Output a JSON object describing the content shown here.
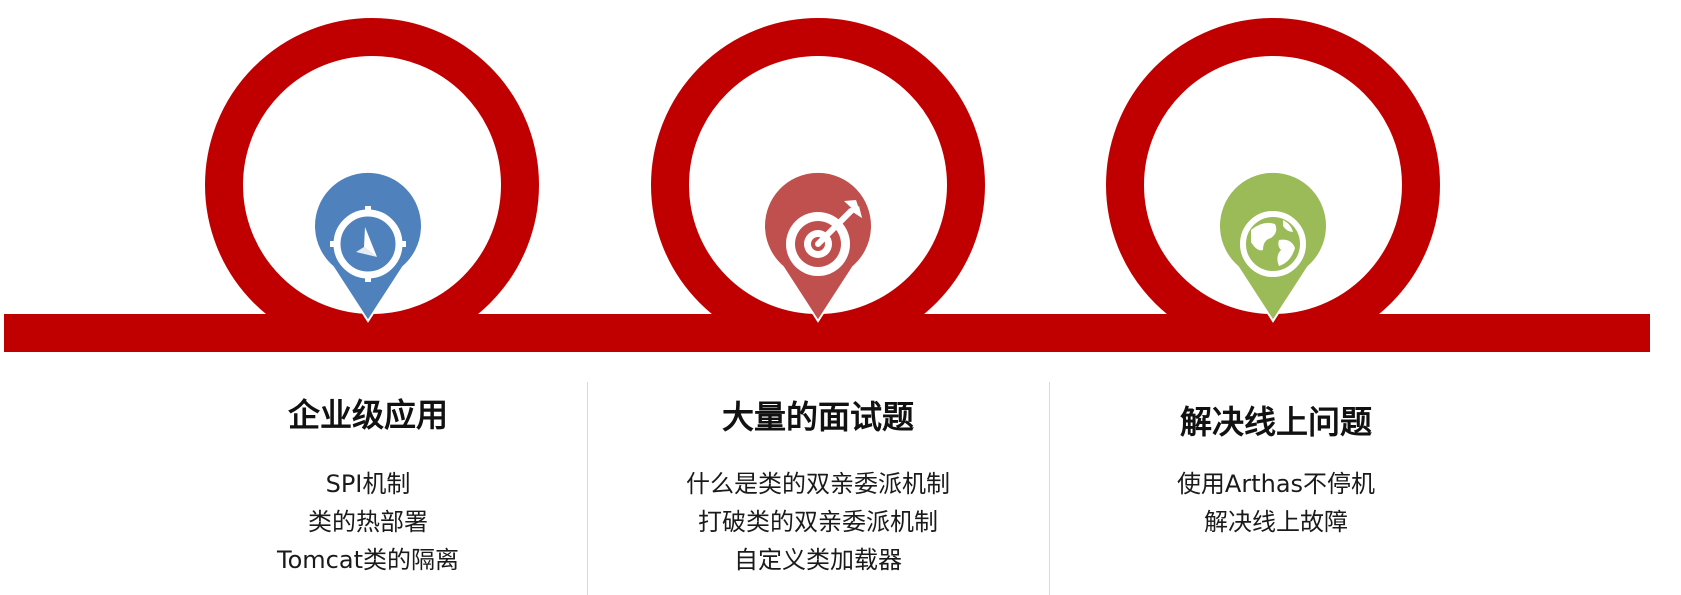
{
  "colors": {
    "track": "#c00000",
    "pin_1": "#4f81bd",
    "pin_2": "#c0504d",
    "pin_3": "#9bbb59",
    "divider": "#d9d9d9"
  },
  "columns": [
    {
      "icon": "compass-icon",
      "title": "企业级应用",
      "items": [
        "SPI机制",
        "类的热部署",
        "Tomcat类的隔离"
      ]
    },
    {
      "icon": "target-icon",
      "title": "大量的面试题",
      "items": [
        "什么是类的双亲委派机制",
        "打破类的双亲委派机制",
        "自定义类加载器"
      ]
    },
    {
      "icon": "globe-icon",
      "title": "解决线上问题",
      "items": [
        "使用Arthas不停机",
        "解决线上故障"
      ]
    }
  ]
}
